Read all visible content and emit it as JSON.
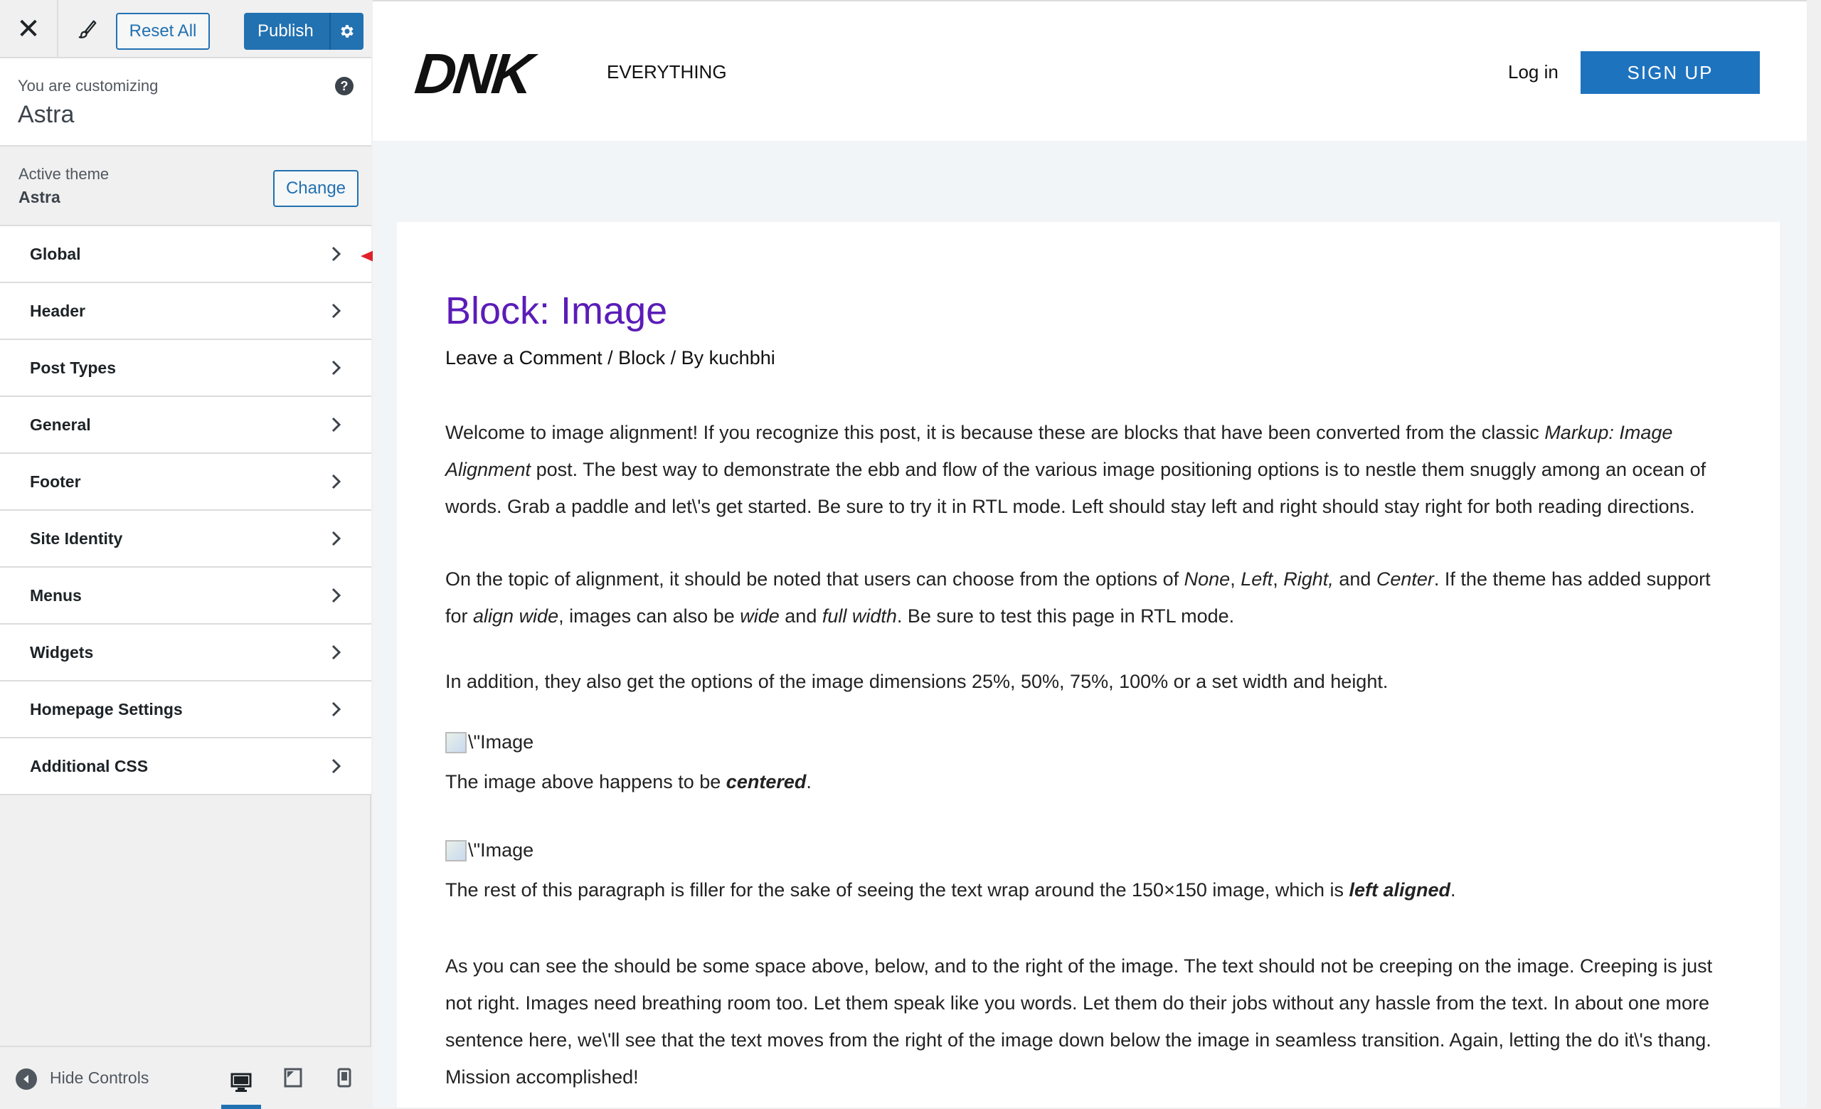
{
  "toolbar": {
    "close_glyph": "✕",
    "reset_label": "Reset All",
    "publish_label": "Publish"
  },
  "customizing": {
    "label": "You are customizing",
    "theme": "Astra",
    "help_glyph": "?"
  },
  "active_theme": {
    "label": "Active theme",
    "name": "Astra",
    "change_label": "Change"
  },
  "panels": [
    {
      "label": "Global"
    },
    {
      "label": "Header"
    },
    {
      "label": "Post Types"
    },
    {
      "label": "General"
    },
    {
      "label": "Footer"
    },
    {
      "label": "Site Identity"
    },
    {
      "label": "Menus"
    },
    {
      "label": "Widgets"
    },
    {
      "label": "Homepage Settings"
    },
    {
      "label": "Additional CSS"
    }
  ],
  "footer": {
    "hide_label": "Hide Controls"
  },
  "colors": {
    "accent": "#2271b1",
    "annotation_arrow": "#e0202a",
    "post_title": "#5b1cb8",
    "signup": "#1e73be"
  },
  "site": {
    "logo": "DNK",
    "nav_item": "EVERYTHING",
    "login": "Log in",
    "signup": "SIGN UP"
  },
  "post": {
    "title": "Block: Image",
    "meta": "Leave a Comment / Block / By kuchbhi",
    "p1_a": "Welcome to image alignment! If you recognize this post, it is because these are blocks that have been converted from the classic ",
    "p1_em": "Markup: Image Alignment",
    "p1_b": " post. The best way to demonstrate the ebb and flow of the various image positioning options is to nestle them snuggly among an ocean of words. Grab a paddle and let\\'s get started. Be sure to try it in RTL mode. Left should stay left and right should stay right for both reading directions.",
    "p2_a": "On the topic of alignment, it should be noted that users can choose from the options of ",
    "p2_em1": "None",
    "p2_s1": ", ",
    "p2_em2": "Left",
    "p2_s2": ", ",
    "p2_em3": "Right,",
    "p2_s3": " and ",
    "p2_em4": "Center",
    "p2_b": ". If the theme has added support for ",
    "p2_em5": "align wide",
    "p2_c": ", images can also be ",
    "p2_em6": "wide",
    "p2_d": " and ",
    "p2_em7": "full width",
    "p2_e": ". Be sure to test this page in RTL mode.",
    "p3": "In addition, they also get the options of the image dimensions 25%, 50%, 75%, 100% or a set width and height.",
    "img1_alt": "\\\"Image",
    "caption1_a": "The image above happens to be ",
    "caption1_em": "centered",
    "caption1_b": ".",
    "img2_alt": "\\\"Image",
    "caption2_a": "The rest of this paragraph is filler for the sake of seeing the text wrap around the 150×150 image, which is ",
    "caption2_em": "left aligned",
    "caption2_b": ".",
    "p4": "As you can see the should be some space above, below, and to the right of the image. The text should not be creeping on the image. Creeping is just not right. Images need breathing room too. Let them speak like you words. Let them do their jobs without any hassle from the text. In about one more sentence here, we\\'ll see that the text moves from the right of the image down below the image in seamless transition. Again, letting the do it\\'s thang. Mission accomplished!"
  },
  "icons": [
    "close-icon",
    "brush-icon",
    "gear-icon",
    "help-icon",
    "chevron-right-icon",
    "hide-controls-icon",
    "desktop-icon",
    "tablet-icon",
    "mobile-icon",
    "arrow-annotation"
  ]
}
